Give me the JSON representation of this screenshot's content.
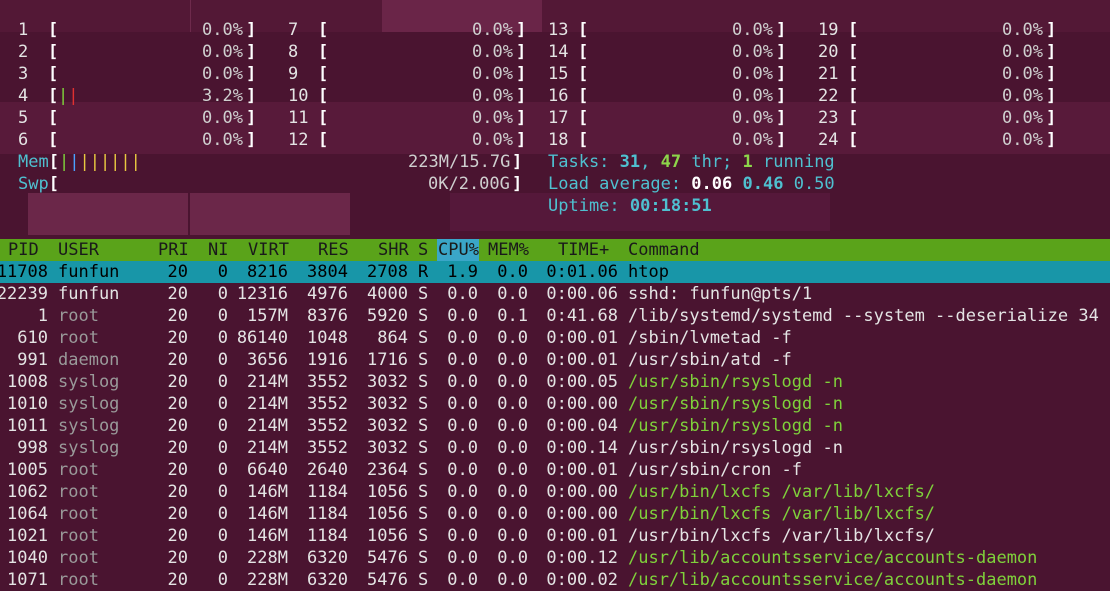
{
  "app": {
    "title": "htop"
  },
  "cpus": [
    {
      "n": "1",
      "pct": "0.0%"
    },
    {
      "n": "2",
      "pct": "0.0%"
    },
    {
      "n": "3",
      "pct": "0.0%"
    },
    {
      "n": "4",
      "pct": "3.2%"
    },
    {
      "n": "5",
      "pct": "0.0%"
    },
    {
      "n": "6",
      "pct": "0.0%"
    },
    {
      "n": "7",
      "pct": "0.0%"
    },
    {
      "n": "8",
      "pct": "0.0%"
    },
    {
      "n": "9",
      "pct": "0.0%"
    },
    {
      "n": "10",
      "pct": "0.0%"
    },
    {
      "n": "11",
      "pct": "0.0%"
    },
    {
      "n": "12",
      "pct": "0.0%"
    },
    {
      "n": "13",
      "pct": "0.0%"
    },
    {
      "n": "14",
      "pct": "0.0%"
    },
    {
      "n": "15",
      "pct": "0.0%"
    },
    {
      "n": "16",
      "pct": "0.0%"
    },
    {
      "n": "17",
      "pct": "0.0%"
    },
    {
      "n": "18",
      "pct": "0.0%"
    },
    {
      "n": "19",
      "pct": "0.0%"
    },
    {
      "n": "20",
      "pct": "0.0%"
    },
    {
      "n": "21",
      "pct": "0.0%"
    },
    {
      "n": "22",
      "pct": "0.0%"
    },
    {
      "n": "23",
      "pct": "0.0%"
    },
    {
      "n": "24",
      "pct": "0.0%"
    }
  ],
  "mem": {
    "label": "Mem",
    "value": "223M/15.7G"
  },
  "swp": {
    "label": "Swp",
    "value": "0K/2.00G"
  },
  "tasks": {
    "label": "Tasks: ",
    "tasks": "31",
    "sep": ", ",
    "threads": "47",
    "thr_label": " thr; ",
    "running": "1",
    "running_label": " running"
  },
  "load": {
    "label": "Load average: ",
    "l1": "0.06",
    "l5": "0.46",
    "l15": "0.50"
  },
  "uptime": {
    "label": "Uptime: ",
    "value": "00:18:51"
  },
  "columns": [
    "PID",
    "USER",
    "PRI",
    "NI",
    "VIRT",
    "RES",
    "SHR",
    "S",
    "CPU%",
    "MEM%",
    "TIME+",
    "Command"
  ],
  "processes": [
    {
      "pid": "11708",
      "user": "funfun",
      "pri": "20",
      "ni": "0",
      "virt": "8216",
      "res": "3804",
      "shr": "2708",
      "s": "R",
      "cpu": "1.9",
      "mem": "0.0",
      "time": "0:01.06",
      "cmd": "htop",
      "thread": false,
      "sys": false
    },
    {
      "pid": "22239",
      "user": "funfun",
      "pri": "20",
      "ni": "0",
      "virt": "12316",
      "res": "4976",
      "shr": "4000",
      "s": "S",
      "cpu": "0.0",
      "mem": "0.0",
      "time": "0:00.06",
      "cmd": "sshd: funfun@pts/1",
      "thread": false,
      "sys": false
    },
    {
      "pid": "1",
      "user": "root",
      "pri": "20",
      "ni": "0",
      "virt": "157M",
      "res": "8376",
      "shr": "5920",
      "s": "S",
      "cpu": "0.0",
      "mem": "0.1",
      "time": "0:41.68",
      "cmd": "/lib/systemd/systemd --system --deserialize 34",
      "thread": false,
      "sys": true
    },
    {
      "pid": "610",
      "user": "root",
      "pri": "20",
      "ni": "0",
      "virt": "86140",
      "res": "1048",
      "shr": "864",
      "s": "S",
      "cpu": "0.0",
      "mem": "0.0",
      "time": "0:00.01",
      "cmd": "/sbin/lvmetad -f",
      "thread": false,
      "sys": true
    },
    {
      "pid": "991",
      "user": "daemon",
      "pri": "20",
      "ni": "0",
      "virt": "3656",
      "res": "1916",
      "shr": "1716",
      "s": "S",
      "cpu": "0.0",
      "mem": "0.0",
      "time": "0:00.01",
      "cmd": "/usr/sbin/atd -f",
      "thread": false,
      "sys": true
    },
    {
      "pid": "1008",
      "user": "syslog",
      "pri": "20",
      "ni": "0",
      "virt": "214M",
      "res": "3552",
      "shr": "3032",
      "s": "S",
      "cpu": "0.0",
      "mem": "0.0",
      "time": "0:00.05",
      "cmd": "/usr/sbin/rsyslogd -n",
      "thread": true,
      "sys": true
    },
    {
      "pid": "1010",
      "user": "syslog",
      "pri": "20",
      "ni": "0",
      "virt": "214M",
      "res": "3552",
      "shr": "3032",
      "s": "S",
      "cpu": "0.0",
      "mem": "0.0",
      "time": "0:00.00",
      "cmd": "/usr/sbin/rsyslogd -n",
      "thread": true,
      "sys": true
    },
    {
      "pid": "1011",
      "user": "syslog",
      "pri": "20",
      "ni": "0",
      "virt": "214M",
      "res": "3552",
      "shr": "3032",
      "s": "S",
      "cpu": "0.0",
      "mem": "0.0",
      "time": "0:00.04",
      "cmd": "/usr/sbin/rsyslogd -n",
      "thread": true,
      "sys": true
    },
    {
      "pid": "998",
      "user": "syslog",
      "pri": "20",
      "ni": "0",
      "virt": "214M",
      "res": "3552",
      "shr": "3032",
      "s": "S",
      "cpu": "0.0",
      "mem": "0.0",
      "time": "0:00.14",
      "cmd": "/usr/sbin/rsyslogd -n",
      "thread": false,
      "sys": true
    },
    {
      "pid": "1005",
      "user": "root",
      "pri": "20",
      "ni": "0",
      "virt": "6640",
      "res": "2640",
      "shr": "2364",
      "s": "S",
      "cpu": "0.0",
      "mem": "0.0",
      "time": "0:00.01",
      "cmd": "/usr/sbin/cron -f",
      "thread": false,
      "sys": true
    },
    {
      "pid": "1062",
      "user": "root",
      "pri": "20",
      "ni": "0",
      "virt": "146M",
      "res": "1184",
      "shr": "1056",
      "s": "S",
      "cpu": "0.0",
      "mem": "0.0",
      "time": "0:00.00",
      "cmd": "/usr/bin/lxcfs /var/lib/lxcfs/",
      "thread": true,
      "sys": true
    },
    {
      "pid": "1064",
      "user": "root",
      "pri": "20",
      "ni": "0",
      "virt": "146M",
      "res": "1184",
      "shr": "1056",
      "s": "S",
      "cpu": "0.0",
      "mem": "0.0",
      "time": "0:00.00",
      "cmd": "/usr/bin/lxcfs /var/lib/lxcfs/",
      "thread": true,
      "sys": true
    },
    {
      "pid": "1021",
      "user": "root",
      "pri": "20",
      "ni": "0",
      "virt": "146M",
      "res": "1184",
      "shr": "1056",
      "s": "S",
      "cpu": "0.0",
      "mem": "0.0",
      "time": "0:00.01",
      "cmd": "/usr/bin/lxcfs /var/lib/lxcfs/",
      "thread": false,
      "sys": true
    },
    {
      "pid": "1040",
      "user": "root",
      "pri": "20",
      "ni": "0",
      "virt": "228M",
      "res": "6320",
      "shr": "5476",
      "s": "S",
      "cpu": "0.0",
      "mem": "0.0",
      "time": "0:00.12",
      "cmd": "/usr/lib/accountsservice/accounts-daemon",
      "thread": true,
      "sys": true
    },
    {
      "pid": "1071",
      "user": "root",
      "pri": "20",
      "ni": "0",
      "virt": "228M",
      "res": "6320",
      "shr": "5476",
      "s": "S",
      "cpu": "0.0",
      "mem": "0.0",
      "time": "0:00.02",
      "cmd": "/usr/lib/accountsservice/accounts-daemon",
      "thread": true,
      "sys": true
    }
  ]
}
